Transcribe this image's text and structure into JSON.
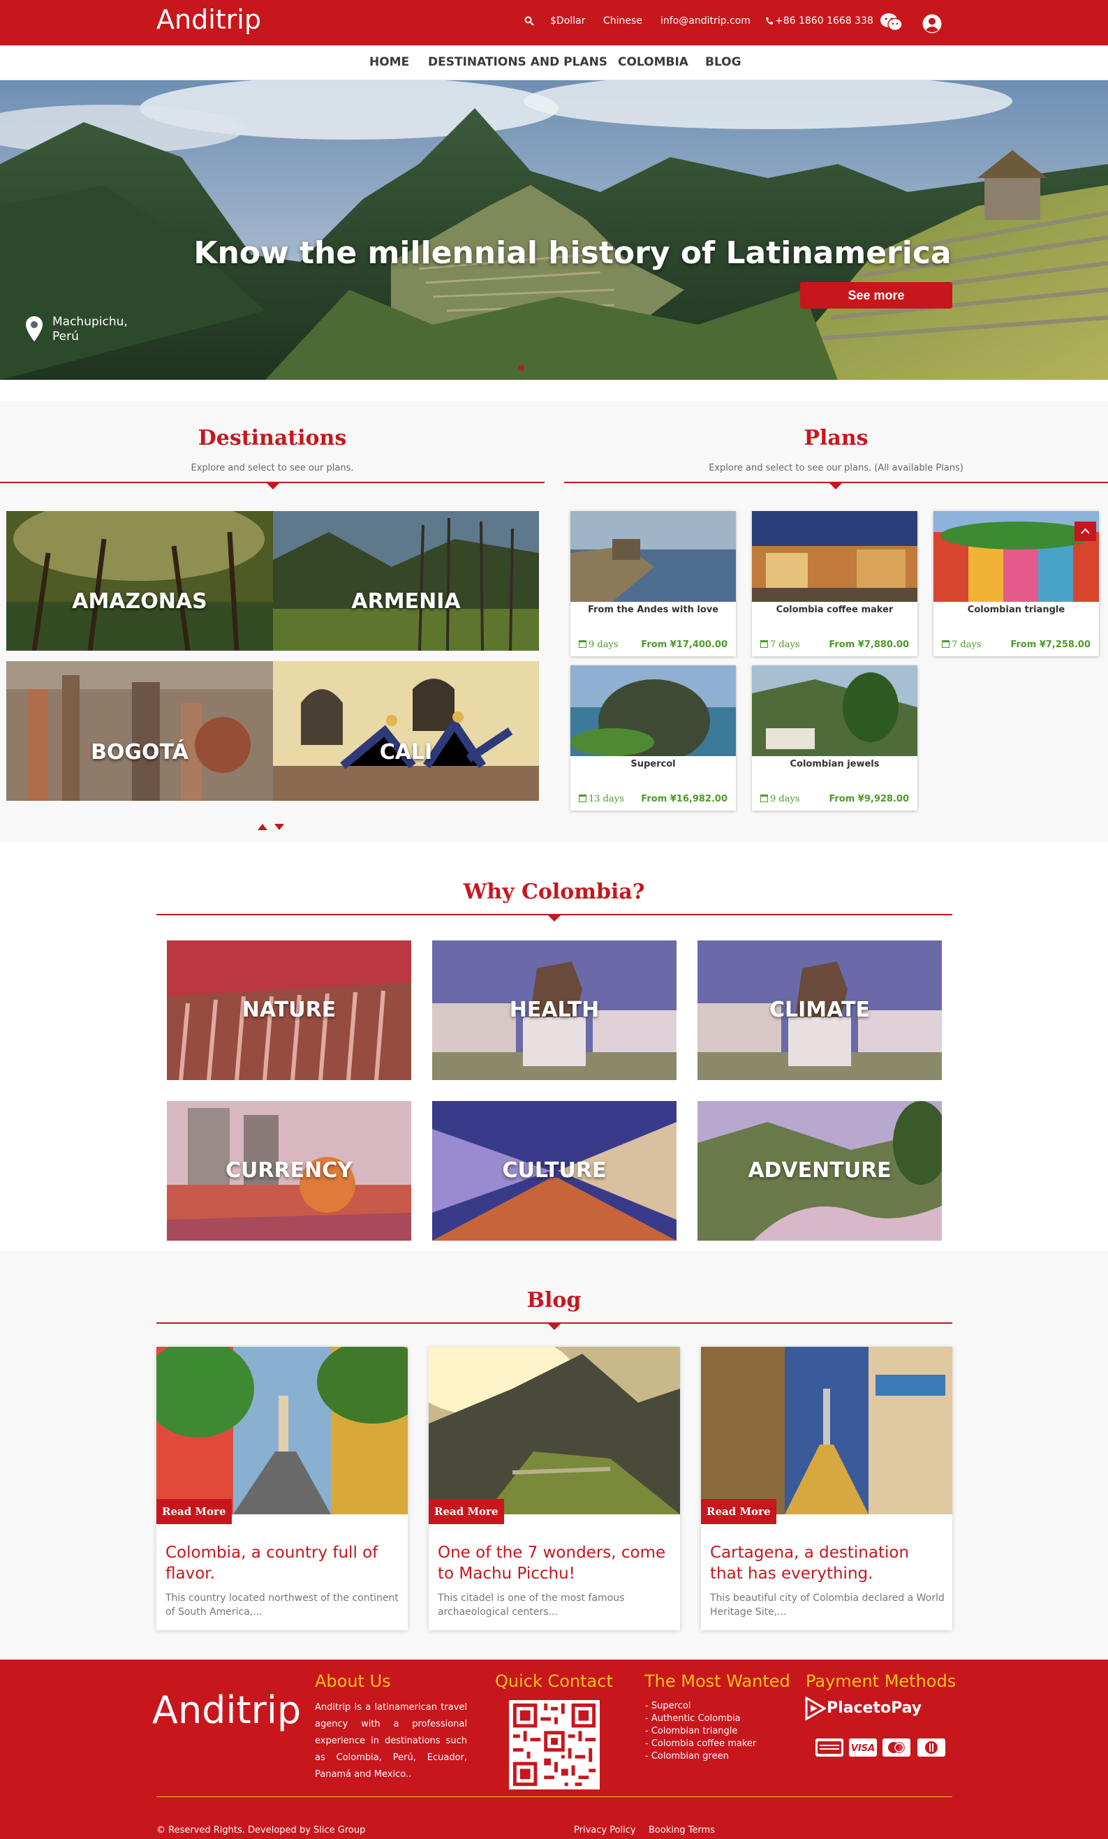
{
  "header": {
    "logo": "Anditrip",
    "currency": "$Dollar",
    "language": "Chinese",
    "email": "info@anditrip.com",
    "phone": "+86 1860 1668 338"
  },
  "nav": {
    "items": [
      "HOME",
      "DESTINATIONS AND PLANS",
      "COLOMBIA",
      "BLOG"
    ]
  },
  "hero": {
    "title": "Know the millennial history of Latinamerica",
    "button": "See more",
    "location_line1": "Machupichu,",
    "location_line2": "Perú"
  },
  "destinations": {
    "title": "Destinations",
    "subtitle": "Explore and select to see our plans.",
    "items": [
      "AMAZONAS",
      "ARMENIA",
      "BOGOTÁ",
      "CALI"
    ]
  },
  "plans": {
    "title": "Plans",
    "subtitle": "Explore and select to see our plans. (All available Plans)",
    "items": [
      {
        "name": "From the Andes with love",
        "days": "9 days",
        "price": "From ¥17,400.00"
      },
      {
        "name": "Colombia coffee maker",
        "days": "7 days",
        "price": "From ¥7,880.00"
      },
      {
        "name": "Colombian triangle",
        "days": "7 days",
        "price": "From ¥7,258.00"
      },
      {
        "name": "Supercol",
        "days": "13 days",
        "price": "From ¥16,982.00"
      },
      {
        "name": "Colombian jewels",
        "days": "9 days",
        "price": "From ¥9,928.00"
      }
    ]
  },
  "why": {
    "title": "Why Colombia?",
    "items": [
      "NATURE",
      "HEALTH",
      "CLIMATE",
      "CURRENCY",
      "CULTURE",
      "ADVENTURE"
    ]
  },
  "blog": {
    "title": "Blog",
    "read_more": "Read More",
    "posts": [
      {
        "title": "Colombia, a country full of flavor.",
        "text": "This country located northwest of the continent of South America,..."
      },
      {
        "title": "One of the 7 wonders, come to Machu Picchu!",
        "text": "This citadel is one of the most famous archaeological centers..."
      },
      {
        "title": "Cartagena, a destination that has everything.",
        "text": "This beautiful city of Colombia declared a World Heritage Site,..."
      }
    ]
  },
  "footer": {
    "logo": "Anditrip",
    "about_title": "About Us",
    "about_text": "Anditrip is a latinamerican travel agency with a professional experience in destinations such as Colombia, Perú, Ecuador, Panamá and Mexico..",
    "contact_title": "Quick Contact",
    "most_wanted_title": "The Most Wanted",
    "most_wanted": [
      "- Supercol",
      "- Authentic Colombia",
      "- Colombian triangle",
      "- Colombia coffee maker",
      "- Colombian green"
    ],
    "payment_title": "Payment Methods",
    "payment_brand": "PlacetoPay",
    "rights": "© Reserved Rights. Developed by Slice Group",
    "privacy": "Privacy Policy",
    "booking": "Booking Terms"
  },
  "colors": {
    "brand_red": "#c8161d",
    "footer_heading": "#f5c518",
    "plan_green": "#4c9a2a"
  }
}
